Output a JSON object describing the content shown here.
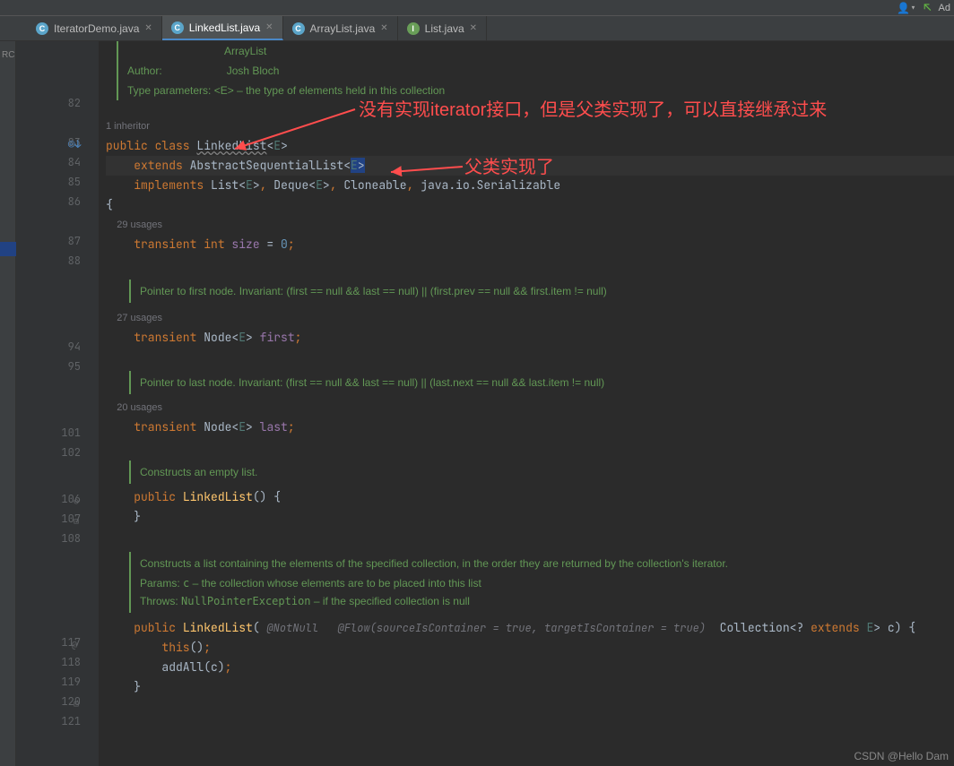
{
  "topbar": {
    "add_label": "Ad"
  },
  "tabs": [
    {
      "icon": "C",
      "iconClass": "file-icon-c",
      "label": "IteratorDemo.java",
      "active": false
    },
    {
      "icon": "C",
      "iconClass": "file-icon-c",
      "label": "LinkedList.java",
      "active": true
    },
    {
      "icon": "C",
      "iconClass": "file-icon-c",
      "label": "ArrayList.java",
      "active": false
    },
    {
      "icon": "I",
      "iconClass": "file-icon-i",
      "label": "List.java",
      "active": false
    }
  ],
  "sidebar_label": "RC",
  "annotations": {
    "top": "没有实现iterator接口，但是父类实现了，可以直接继承过来",
    "mid": "父类实现了"
  },
  "watermark": "CSDN @Hello Dam",
  "doc_header": {
    "arraylist": "ArrayList",
    "author_label": "Author:",
    "author_value": "Josh Bloch",
    "typeparams_label": "Type parameters:",
    "typeparams_value": "<E> – the type of elements held in this collection"
  },
  "hints": {
    "inheritor": "1 inheritor",
    "usages29": "29 usages",
    "usages27": "27 usages",
    "usages20": "20 usages"
  },
  "doc_first": "Pointer to first node. Invariant: (first == null && last == null) || (first.prev == null && first.item != null)",
  "doc_last": "Pointer to last node. Invariant: (first == null && last == null) || (last.next == null && last.item != null)",
  "doc_empty": "Constructs an empty list.",
  "doc_ctor2_l1": "Constructs a list containing the elements of the specified collection, in the order they are returned by the collection's iterator.",
  "doc_ctor2_params_label": "Params:",
  "doc_ctor2_params_c": "c",
  "doc_ctor2_params_rest": " – the collection whose elements are to be placed into this list",
  "doc_ctor2_throws_label": "Throws:",
  "doc_ctor2_throws_cls": "NullPointerException",
  "doc_ctor2_throws_rest": " – if the specified collection is null",
  "param_anno": "@NotNull   @Flow(sourceIsContainer = true, targetIsContainer = true)",
  "line_numbers": [
    "82",
    "83",
    "84",
    "85",
    "86",
    "87",
    "88",
    "94",
    "95",
    "101",
    "102",
    "106",
    "107",
    "108",
    "117",
    "118",
    "119",
    "120",
    "121"
  ],
  "code": {
    "l83": {
      "public": "public ",
      "class": "class ",
      "name": "LinkedList",
      "gen": "<",
      "e": "E",
      "close": ">"
    },
    "l84": {
      "extends": "extends ",
      "cls": "AbstractSequentialList",
      "open": "<",
      "e": "E",
      "close": ">"
    },
    "l85": {
      "implements": "implements ",
      "list": "List",
      "deque": "Deque",
      "clone": "Cloneable",
      "serial": "java.io.Serializable",
      "e": "E"
    },
    "l86": "{",
    "l87": {
      "transient": "transient ",
      "int": "int ",
      "size": "size",
      "eq": " = ",
      "zero": "0",
      "semi": ";"
    },
    "l94": {
      "transient": "transient ",
      "node": "Node",
      "e": "E",
      "first": "first",
      "semi": ";"
    },
    "l101": {
      "transient": "transient ",
      "node": "Node",
      "e": "E",
      "last": "last",
      "semi": ";"
    },
    "l106": {
      "public": "public ",
      "name": "LinkedList",
      "parens": "()",
      "brace": " {"
    },
    "l107": "}",
    "l117": {
      "public": "public ",
      "name": "LinkedList",
      "open": "( ",
      "coll": "Collection",
      "wild": "<? ",
      "extends": "extends ",
      "e": "E",
      "close": "> ",
      "c": "c",
      "end": ") {"
    },
    "l118": {
      "this": "this",
      "call": "()",
      "semi": ";"
    },
    "l119": {
      "addAll": "addAll",
      "open": "(",
      "c": "c",
      "close": ")",
      "semi": ";"
    },
    "l120": "}"
  }
}
